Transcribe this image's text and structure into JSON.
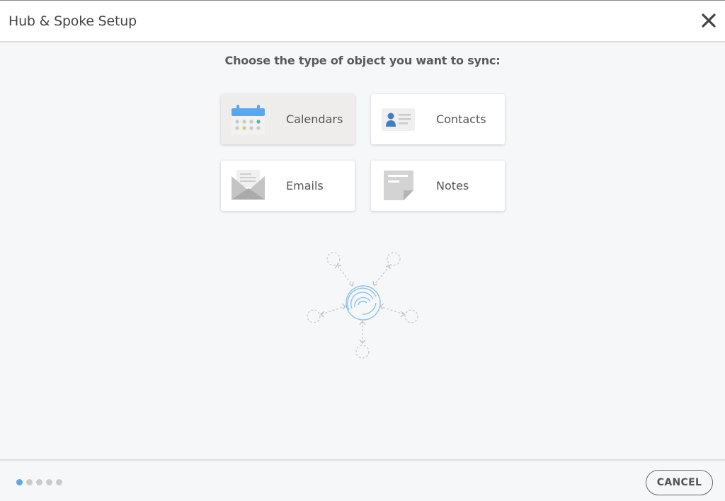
{
  "window": {
    "title": "Hub & Spoke Setup",
    "close_icon": "close-icon"
  },
  "main": {
    "prompt": "Choose the type of object you want to sync:",
    "options": [
      {
        "label": "Calendars",
        "icon": "calendar-icon",
        "selected": true
      },
      {
        "label": "Contacts",
        "icon": "contact-card-icon",
        "selected": false
      },
      {
        "label": "Emails",
        "icon": "envelope-icon",
        "selected": false
      },
      {
        "label": "Notes",
        "icon": "note-icon",
        "selected": false
      }
    ],
    "illustration": "hub-spoke-icon"
  },
  "footer": {
    "steps_total": 5,
    "current_step": 1,
    "cancel_label": "CANCEL"
  },
  "colors": {
    "accent": "#5aa7f0",
    "selected_card": "#efedec",
    "inactive_dot": "#cccbcb"
  }
}
